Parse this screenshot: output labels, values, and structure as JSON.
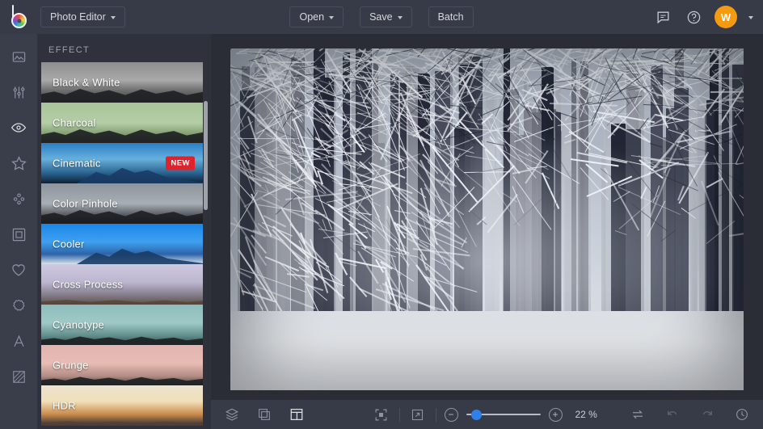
{
  "app": {
    "logo_icon": "bepic-color-wheel-logo",
    "menu_label": "Photo Editor"
  },
  "header": {
    "open_label": "Open",
    "save_label": "Save",
    "batch_label": "Batch",
    "feedback_icon": "comment-icon",
    "help_icon": "question-circle-icon",
    "avatar_initial": "W",
    "avatar_color": "#f59a11"
  },
  "rail": {
    "items": [
      {
        "name": "image-icon",
        "label": "Image"
      },
      {
        "name": "adjust-icon",
        "label": "Adjust"
      },
      {
        "name": "eye-icon",
        "label": "Effects"
      },
      {
        "name": "star-icon",
        "label": "Favorites"
      },
      {
        "name": "nodes-icon",
        "label": "Overlays"
      },
      {
        "name": "frame-icon",
        "label": "Frames"
      },
      {
        "name": "heart-icon",
        "label": "Stickers"
      },
      {
        "name": "badge-icon",
        "label": "Badges"
      },
      {
        "name": "text-icon",
        "label": "Text"
      },
      {
        "name": "texture-icon",
        "label": "Texture"
      }
    ],
    "active_index": 2
  },
  "panel": {
    "title": "EFFECT",
    "selected": "Cooler",
    "items": [
      {
        "label": "Black & White",
        "thumb": "th-bw",
        "badge": null,
        "selected": false
      },
      {
        "label": "Charcoal",
        "thumb": "th-char",
        "badge": null,
        "selected": false
      },
      {
        "label": "Cinematic",
        "thumb": "th-cine",
        "badge": "NEW",
        "selected": false
      },
      {
        "label": "Color Pinhole",
        "thumb": "th-pin",
        "badge": null,
        "selected": false
      },
      {
        "label": "Cooler",
        "thumb": "th-cool",
        "badge": null,
        "selected": true
      },
      {
        "label": "Cross Process",
        "thumb": "th-cross",
        "badge": null,
        "selected": false
      },
      {
        "label": "Cyanotype",
        "thumb": "th-cyan",
        "badge": null,
        "selected": false
      },
      {
        "label": "Grunge",
        "thumb": "th-grun",
        "badge": null,
        "selected": false
      },
      {
        "label": "HDR",
        "thumb": "th-hdr",
        "badge": null,
        "selected": false
      }
    ],
    "selection_color": "#e8431f",
    "badge_color": "#e0222b"
  },
  "canvas": {
    "image_alt": "Snowy winter beech forest with frost-covered branches",
    "background": "#2b2d36"
  },
  "bottombar": {
    "layers_icon": "layers-icon",
    "crop_icon": "overlap-squares-icon",
    "layout_icon": "panel-layout-icon",
    "fit_icon": "fit-to-screen-icon",
    "expand_icon": "expand-arrow-icon",
    "zoom_out_label": "−",
    "zoom_in_label": "+",
    "zoom_value": "22 %",
    "slider_percent": 8,
    "slider_accent": "#2f80ea",
    "compare_icon": "compare-swap-icon",
    "undo_icon": "undo-arrow-icon",
    "redo_icon": "redo-arrow-icon",
    "history_icon": "history-clock-icon"
  }
}
